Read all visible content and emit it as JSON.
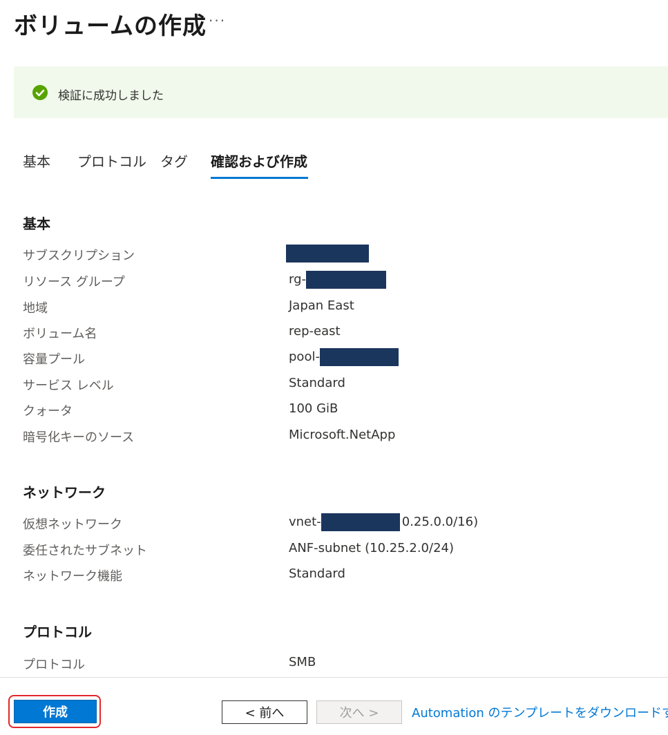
{
  "header": {
    "title": "ボリュームの作成",
    "more_label": "···"
  },
  "banner": {
    "icon": "check-circle-icon",
    "text": "検証に成功しました",
    "icon_color": "#57a300"
  },
  "tabs": [
    {
      "label": "基本",
      "active": false
    },
    {
      "label": "プロトコル",
      "active": false
    },
    {
      "label": "タグ",
      "active": false
    },
    {
      "label": "確認および作成",
      "active": true
    }
  ],
  "sections": {
    "basic": {
      "heading": "基本",
      "rows": [
        {
          "label": "サブスクリプション",
          "value": ""
        },
        {
          "label": "リソース グループ",
          "value": "rg-"
        },
        {
          "label": "地域",
          "value": "Japan East"
        },
        {
          "label": "ボリューム名",
          "value": "rep-east"
        },
        {
          "label": "容量プール",
          "value": "pool-"
        },
        {
          "label": "サービス レベル",
          "value": "Standard"
        },
        {
          "label": "クォータ",
          "value": "100 GiB"
        },
        {
          "label": "暗号化キーのソース",
          "value": "Microsoft.NetApp"
        }
      ]
    },
    "network": {
      "heading": "ネットワーク",
      "rows": [
        {
          "label": "仮想ネットワーク",
          "value": "vnet-",
          "value_suffix": "0.25.0.0/16)"
        },
        {
          "label": "委任されたサブネット",
          "value": "ANF-subnet (10.25.2.0/24)"
        },
        {
          "label": "ネットワーク機能",
          "value": "Standard"
        }
      ]
    },
    "protocol": {
      "heading": "プロトコル",
      "rows": [
        {
          "label": "プロトコル",
          "value": "SMB"
        }
      ]
    }
  },
  "footer": {
    "create_label": "作成",
    "prev_label": "< 前へ",
    "next_label": "次へ >",
    "download_label": "Automation のテンプレートをダウンロードする"
  },
  "colors": {
    "accent": "#0078d4",
    "redaction": "#1b365d",
    "highlight_outline": "#e3262d"
  }
}
